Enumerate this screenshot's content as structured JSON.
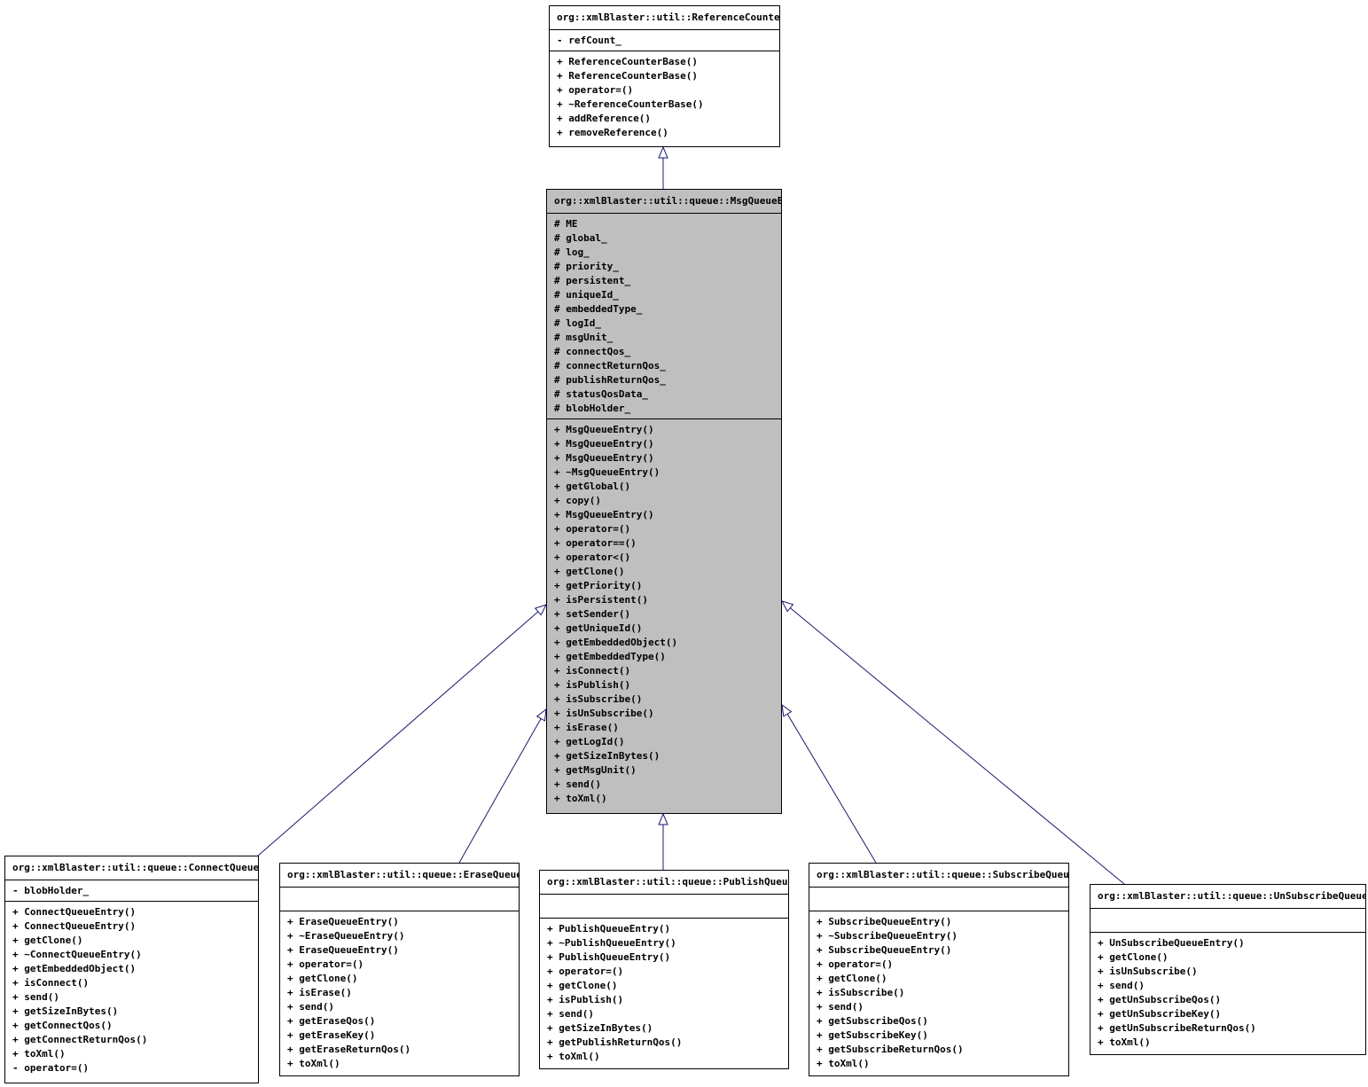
{
  "classes": [
    {
      "id": "ref",
      "name": "org::xmlBlaster::util::ReferenceCounterBase",
      "attributes": [
        "- refCount_"
      ],
      "operations": [
        "+ ReferenceCounterBase()",
        "+ ReferenceCounterBase()",
        "+ operator=()",
        "+ ~ReferenceCounterBase()",
        "+ addReference()",
        "+ removeReference()"
      ]
    },
    {
      "id": "msg",
      "name": "org::xmlBlaster::util::queue::MsgQueueEntry",
      "attributes": [
        "# ME",
        "# global_",
        "# log_",
        "# priority_",
        "# persistent_",
        "# uniqueId_",
        "# embeddedType_",
        "# logId_",
        "# msgUnit_",
        "# connectQos_",
        "# connectReturnQos_",
        "# publishReturnQos_",
        "# statusQosData_",
        "# blobHolder_"
      ],
      "operations": [
        "+ MsgQueueEntry()",
        "+ MsgQueueEntry()",
        "+ MsgQueueEntry()",
        "+ ~MsgQueueEntry()",
        "+ getGlobal()",
        "+ copy()",
        "+ MsgQueueEntry()",
        "+ operator=()",
        "+ operator==()",
        "+ operator<()",
        "+ getClone()",
        "+ getPriority()",
        "+ isPersistent()",
        "+ setSender()",
        "+ getUniqueId()",
        "+ getEmbeddedObject()",
        "+ getEmbeddedType()",
        "+ isConnect()",
        "+ isPublish()",
        "+ isSubscribe()",
        "+ isUnSubscribe()",
        "+ isErase()",
        "+ getLogId()",
        "+ getSizeInBytes()",
        "+ getMsgUnit()",
        "+ send()",
        "+ toXml()"
      ]
    },
    {
      "id": "connect",
      "name": "org::xmlBlaster::util::queue::ConnectQueueEntry",
      "attributes": [
        "- blobHolder_"
      ],
      "operations": [
        "+ ConnectQueueEntry()",
        "+ ConnectQueueEntry()",
        "+ getClone()",
        "+ ~ConnectQueueEntry()",
        "+ getEmbeddedObject()",
        "+ isConnect()",
        "+ send()",
        "+ getSizeInBytes()",
        "+ getConnectQos()",
        "+ getConnectReturnQos()",
        "+ toXml()",
        "- operator=()"
      ]
    },
    {
      "id": "erase",
      "name": "org::xmlBlaster::util::queue::EraseQueueEntry",
      "attributes": [],
      "operations": [
        "+ EraseQueueEntry()",
        "+ ~EraseQueueEntry()",
        "+ EraseQueueEntry()",
        "+ operator=()",
        "+ getClone()",
        "+ isErase()",
        "+ send()",
        "+ getEraseQos()",
        "+ getEraseKey()",
        "+ getEraseReturnQos()",
        "+ toXml()"
      ]
    },
    {
      "id": "publish",
      "name": "org::xmlBlaster::util::queue::PublishQueueEntry",
      "attributes": [],
      "operations": [
        "+ PublishQueueEntry()",
        "+ ~PublishQueueEntry()",
        "+ PublishQueueEntry()",
        "+ operator=()",
        "+ getClone()",
        "+ isPublish()",
        "+ send()",
        "+ getSizeInBytes()",
        "+ getPublishReturnQos()",
        "+ toXml()"
      ]
    },
    {
      "id": "subscribe",
      "name": "org::xmlBlaster::util::queue::SubscribeQueueEntry",
      "attributes": [],
      "operations": [
        "+ SubscribeQueueEntry()",
        "+ ~SubscribeQueueEntry()",
        "+ SubscribeQueueEntry()",
        "+ operator=()",
        "+ getClone()",
        "+ isSubscribe()",
        "+ send()",
        "+ getSubscribeQos()",
        "+ getSubscribeKey()",
        "+ getSubscribeReturnQos()",
        "+ toXml()"
      ]
    },
    {
      "id": "unsubscribe",
      "name": "org::xmlBlaster::util::queue::UnSubscribeQueueEntry",
      "attributes": [],
      "operations": [
        "+ UnSubscribeQueueEntry()",
        "+ getClone()",
        "+ isUnSubscribe()",
        "+ send()",
        "+ getUnSubscribeQos()",
        "+ getUnSubscribeKey()",
        "+ getUnSubscribeReturnQos()",
        "+ toXml()"
      ]
    }
  ],
  "edges": [
    {
      "from": "msg",
      "to": "ref",
      "kind": "inheritance"
    },
    {
      "from": "connect",
      "to": "msg",
      "kind": "inheritance"
    },
    {
      "from": "erase",
      "to": "msg",
      "kind": "inheritance"
    },
    {
      "from": "publish",
      "to": "msg",
      "kind": "inheritance"
    },
    {
      "from": "subscribe",
      "to": "msg",
      "kind": "inheritance"
    },
    {
      "from": "unsubscribe",
      "to": "msg",
      "kind": "inheritance"
    }
  ],
  "colors": {
    "focus_fill": "#bfbfbf",
    "edge": "#191970",
    "border": "#000000"
  }
}
